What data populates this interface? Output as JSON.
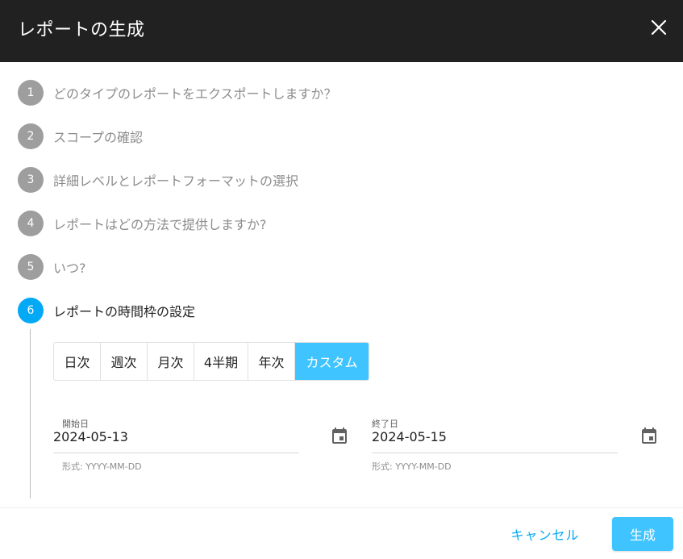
{
  "dialog": {
    "title": "レポートの生成",
    "close_icon": "close-icon"
  },
  "steps": [
    {
      "number": "1",
      "label": "どのタイプのレポートをエクスポートしますか？",
      "active": false
    },
    {
      "number": "2",
      "label": "スコープの確認",
      "active": false
    },
    {
      "number": "3",
      "label": "詳細レベルとレポートフォーマットの選択",
      "active": false
    },
    {
      "number": "4",
      "label": "レポートはどの方法で提供しますか?",
      "active": false
    },
    {
      "number": "5",
      "label": "いつ?",
      "active": false
    },
    {
      "number": "6",
      "label": "レポートの時間枠の設定",
      "active": true
    }
  ],
  "timeframe": {
    "options": [
      "日次",
      "週次",
      "月次",
      "4半期",
      "年次",
      "カスタム"
    ],
    "selected": "カスタム"
  },
  "start_date": {
    "label": "開始日",
    "value": "2024-05-13",
    "hint": "形式: YYYY-MM-DD",
    "icon": "calendar-icon"
  },
  "end_date": {
    "label": "終了日",
    "value": "2024-05-15",
    "hint": "形式: YYYY-MM-DD",
    "icon": "calendar-icon"
  },
  "footer": {
    "cancel_label": "キャンセル",
    "generate_label": "生成"
  },
  "colors": {
    "header_bg": "#212121",
    "accent": "#03a9f4",
    "selected_bg": "#40c4ff",
    "inactive_step": "#9e9e9e"
  }
}
